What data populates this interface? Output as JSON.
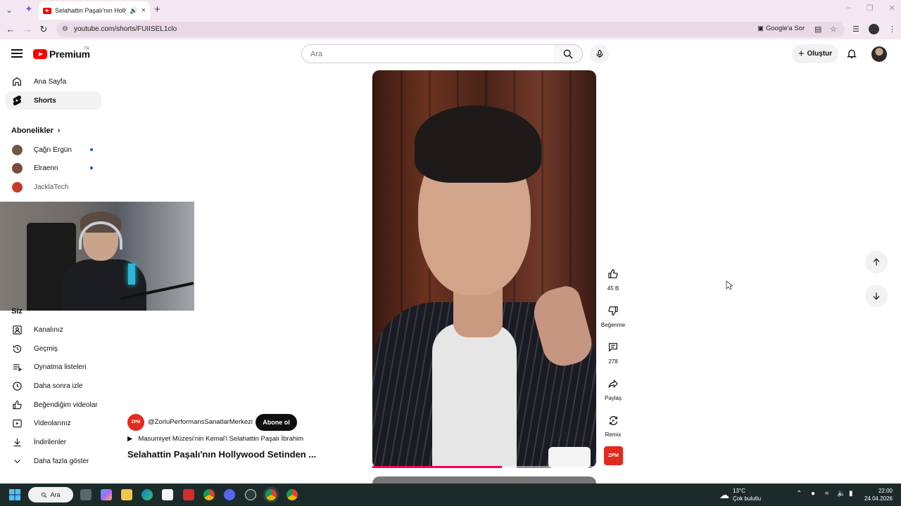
{
  "browser": {
    "tab_title": "Selahattin Paşalı'nın Hollywood",
    "url": "youtube.com/shorts/FUIISEL1clo",
    "google_sor": "Google'a Sor"
  },
  "header": {
    "logo_text": "Premium",
    "region": "TR",
    "search_placeholder": "Ara",
    "create_label": "Oluştur"
  },
  "sidebar": {
    "main": [
      {
        "label": "Ana Sayfa",
        "icon": "home-icon"
      },
      {
        "label": "Shorts",
        "icon": "shorts-icon"
      }
    ],
    "subscriptions_title": "Abonelikler",
    "subscriptions": [
      {
        "label": "Çağrı Ergün",
        "color": "#6b5a48"
      },
      {
        "label": "Elraenn",
        "color": "#7a4a3a"
      },
      {
        "label": "JacklaTech",
        "color": "#c83a2a"
      }
    ],
    "you_title": "Siz",
    "you_items": [
      {
        "label": "Kanalınız",
        "icon": "channel-icon"
      },
      {
        "label": "Geçmiş",
        "icon": "history-icon"
      },
      {
        "label": "Oynatma listeleri",
        "icon": "playlist-icon"
      },
      {
        "label": "Daha sonra izle",
        "icon": "clock-icon"
      },
      {
        "label": "Beğendiğim videolar",
        "icon": "like-icon"
      },
      {
        "label": "Videolarınız",
        "icon": "video-icon"
      },
      {
        "label": "İndirilenler",
        "icon": "download-icon"
      },
      {
        "label": "Daha fazla göster",
        "icon": "chevron-down-icon"
      }
    ]
  },
  "short": {
    "channel": "@ZorluPerformansSanatlarMerkezi",
    "channel_badge": "ZPM",
    "subscribe_label": "Abone ol",
    "music": "Masumiyet Müzesi'nin Kemal'i Selahattin Paşalı İbrahim",
    "title": "Selahattin Paşalı'nın Hollywood Setinden ...",
    "progress": 0.58
  },
  "actions": {
    "likes": "45 B",
    "dislike_label": "Beğenme",
    "comments": "278",
    "share_label": "Paylaş",
    "remix_label": "Remix"
  },
  "taskbar": {
    "search_label": "Ara",
    "temperature": "13°C",
    "weather": "Çok bulutlu",
    "time": "22:00",
    "date": "24.04.2026"
  }
}
